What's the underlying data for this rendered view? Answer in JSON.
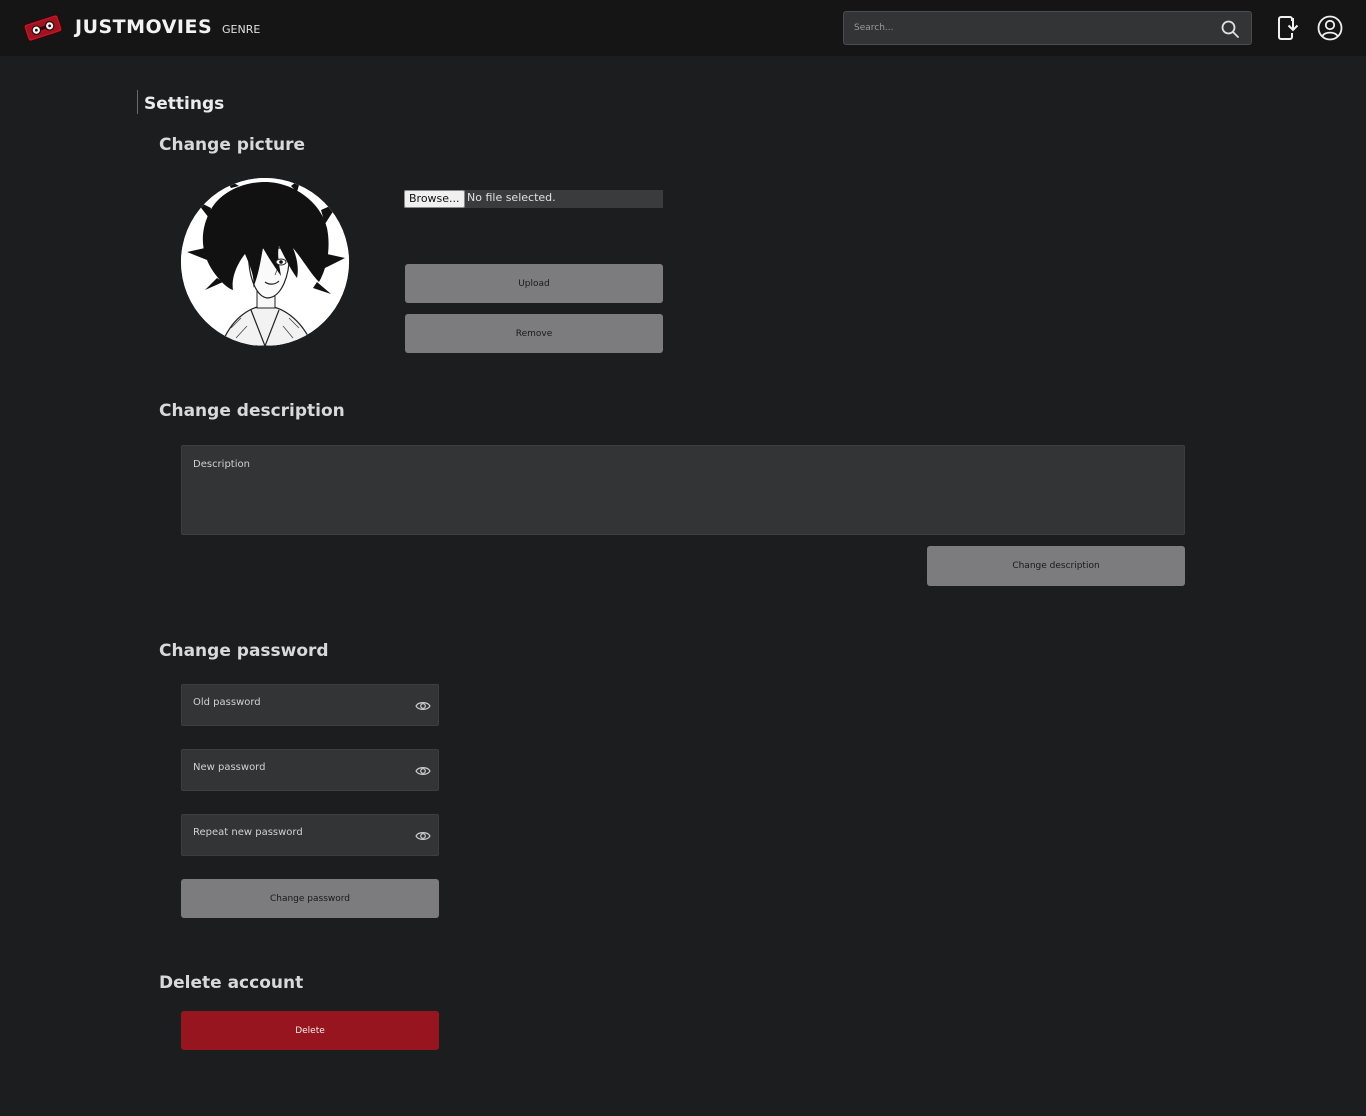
{
  "navbar": {
    "brand": "JUSTMOVIES",
    "genre_label": "GENRE",
    "search_placeholder": "Search...",
    "logo_icon": "film-reel-logo-icon",
    "download_icon": "phone-download-icon",
    "account_icon": "account-circle-icon"
  },
  "page": {
    "title": "Settings"
  },
  "picture": {
    "title": "Change picture",
    "browse_label": "Browse...",
    "file_status": "No file selected.",
    "upload_label": "Upload",
    "remove_label": "Remove"
  },
  "description": {
    "title": "Change description",
    "field_label": "Description",
    "submit_label": "Change description"
  },
  "password": {
    "title": "Change password",
    "old_label": "Old password",
    "new_label": "New password",
    "repeat_label": "Repeat new password",
    "submit_label": "Change password"
  },
  "delete": {
    "title": "Delete account",
    "button_label": "Delete"
  },
  "colors": {
    "background": "#1c1d1f",
    "navbar": "#151515",
    "field": "#333436",
    "button": "#7c7c7e",
    "danger": "#96151f",
    "logo_red": "#c01a2a"
  }
}
